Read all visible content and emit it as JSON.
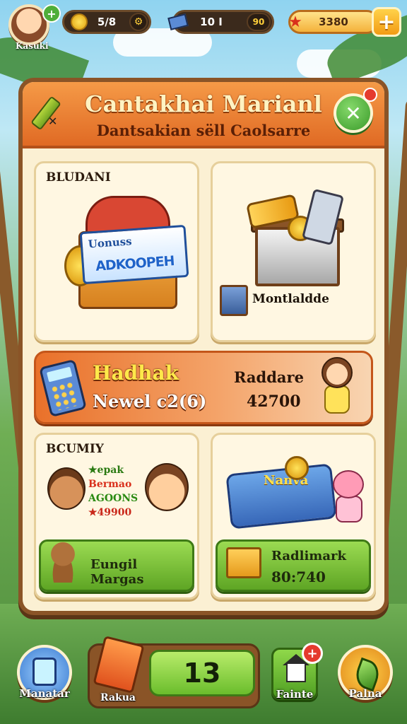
{
  "topbar": {
    "player_name": "Kasuki",
    "coins_value": "5/8",
    "energy_value": "10 I",
    "energy_sub": "90",
    "gems_value": "3380",
    "add_label": "+",
    "avatar_plus": "+"
  },
  "panel": {
    "title": "Cantakhai Marianl",
    "subtitle": "Dantsakian sëll Caolsarre",
    "close_label": "✕",
    "icon_label": "✕"
  },
  "cards": {
    "shop": {
      "label": "BLUDANI",
      "sign_top": "Uonuss",
      "sign_main": "ADKOOPEH"
    },
    "chest": {
      "label": "Montlaldde"
    },
    "banner": {
      "title": "Hadhak",
      "value": "Newel c2(6)",
      "right_label": "Raddare",
      "right_value": "42700"
    },
    "friends": {
      "label": "BCUMIY",
      "list": [
        "★epak",
        "Bermao",
        "AGOONS",
        "★49900"
      ],
      "list_colors": [
        "#2a7a12",
        "#d9301c",
        "#2a8a12",
        "#c9281a"
      ],
      "button_label": "Eungil Margas"
    },
    "tickets": {
      "ticket_text": "Nanva",
      "button_label": "Radlimark",
      "button_value": "80:740"
    }
  },
  "bottombar": {
    "left_label": "Manatar",
    "pack_label": "Rakua",
    "counter_value": "13",
    "home_label": "Fainte",
    "home_badge": "+",
    "right_label": "Palna"
  },
  "colors": {
    "panel_frame": "#8a5427",
    "header_orange": "#e06a24",
    "accent_green": "#5ea524",
    "title_cream": "#fff3c2"
  },
  "icons": [
    "avatar",
    "coin-icon",
    "energy-icon",
    "gem-icon",
    "pencil-icon",
    "close-icon",
    "shop-icon",
    "chest-icon",
    "calculator-icon",
    "monkey-icon",
    "dog-icon",
    "crate-icon",
    "ticket-icon",
    "pig-icon",
    "tablet-icon",
    "card-pack-icon",
    "home-icon",
    "leaf-icon"
  ]
}
